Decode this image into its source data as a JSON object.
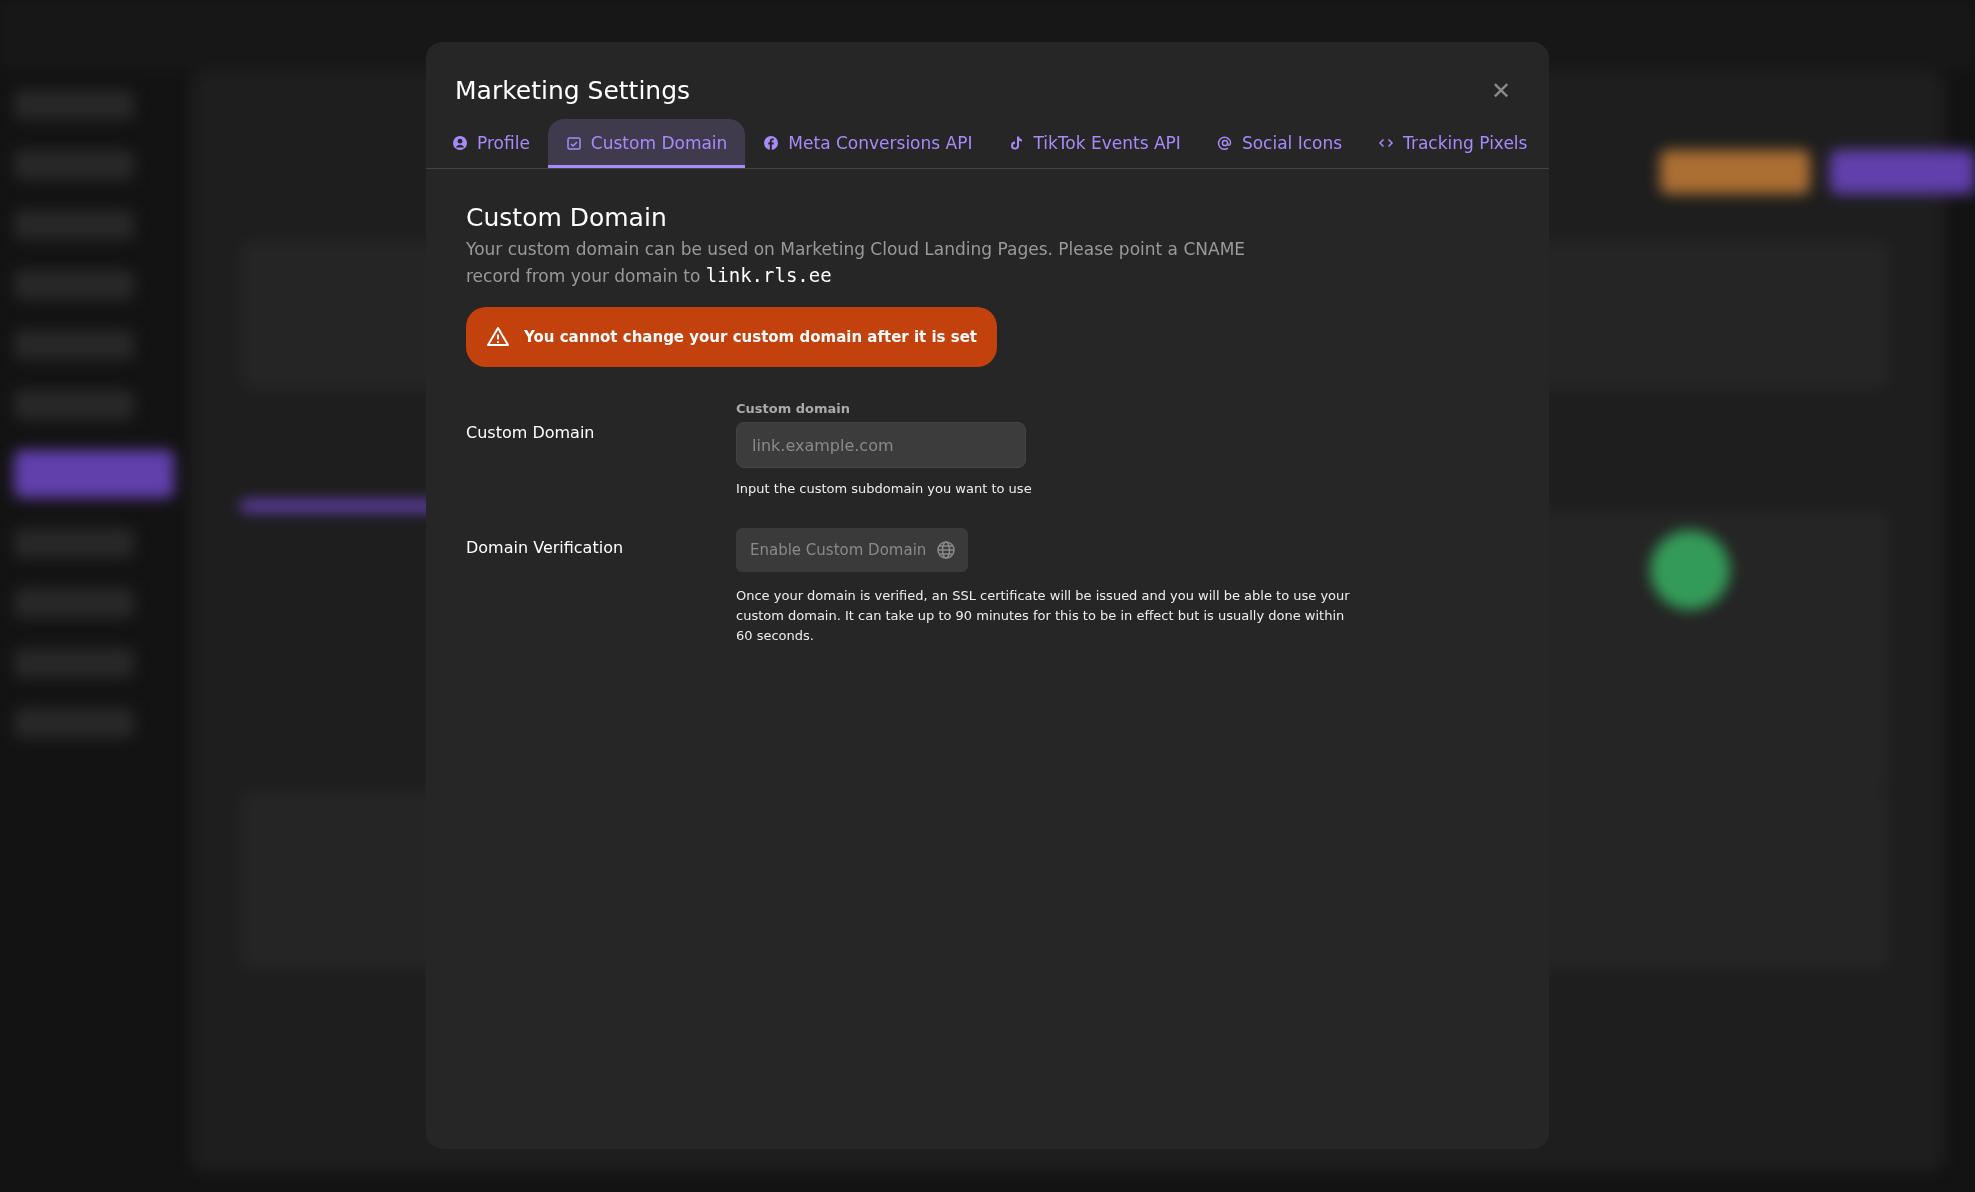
{
  "dialog": {
    "title": "Marketing Settings",
    "close": "✕",
    "tabs": [
      {
        "label": "Profile",
        "selected": false
      },
      {
        "label": "Custom Domain",
        "selected": true
      },
      {
        "label": "Meta Conversions API",
        "selected": false
      },
      {
        "label": "TikTok Events API",
        "selected": false
      },
      {
        "label": "Social Icons",
        "selected": false
      },
      {
        "label": "Tracking Pixels",
        "selected": false
      }
    ],
    "section": {
      "heading": "Custom Domain",
      "description": "Your custom domain can be used on Marketing Cloud Landing Pages. Please point a CNAME record from your domain to",
      "target": "link.rls.ee",
      "warning": "You cannot change your custom domain after it is set",
      "fields": [
        {
          "label": "Custom Domain",
          "field_label": "Custom domain",
          "placeholder": "link.example.com",
          "help": "Input the custom subdomain you want to use"
        }
      ],
      "verification": {
        "label": "Domain Verification",
        "button": "Enable Custom Domain",
        "disabled": true,
        "help": "Once your domain is verified, an SSL certificate will be issued and you will be able to use your custom domain. It can take up to 90 minutes for this to be in effect but is usually done within 60 seconds."
      }
    }
  }
}
